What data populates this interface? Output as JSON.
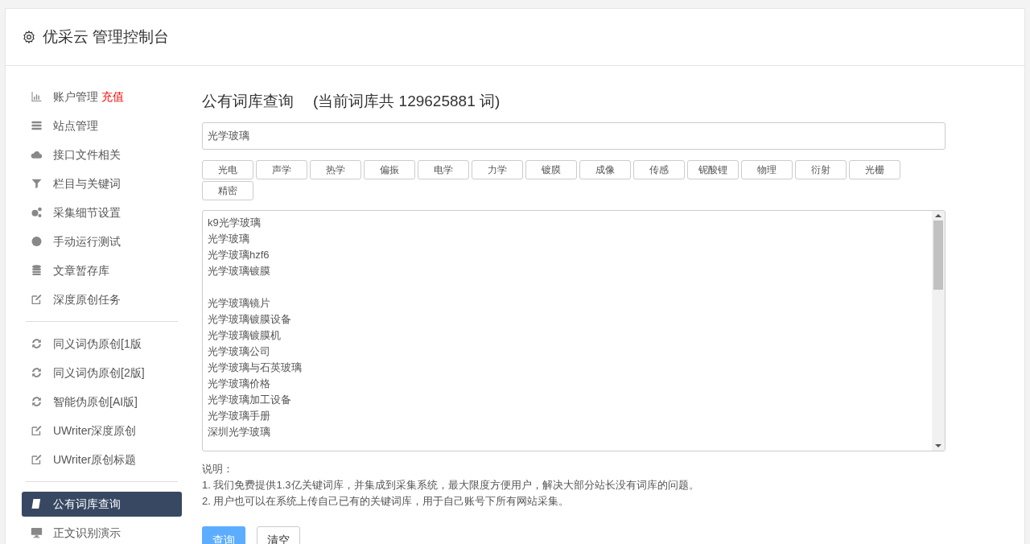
{
  "header": {
    "title": "优采云 管理控制台"
  },
  "sidebar": {
    "groups": [
      {
        "items": [
          {
            "label": "账户管理",
            "badge": "充值",
            "selected": false
          },
          {
            "label": "站点管理",
            "selected": false
          },
          {
            "label": "接口文件相关",
            "selected": false
          },
          {
            "label": "栏目与关键词",
            "selected": false
          },
          {
            "label": "采集细节设置",
            "selected": false
          },
          {
            "label": "手动运行测试",
            "selected": false
          },
          {
            "label": "文章暂存库",
            "selected": false
          },
          {
            "label": "深度原创任务",
            "selected": false
          }
        ]
      },
      {
        "items": [
          {
            "label": "同义词伪原创[1版",
            "selected": false
          },
          {
            "label": "同义词伪原创[2版]",
            "selected": false
          },
          {
            "label": "智能伪原创[AI版]",
            "selected": false
          },
          {
            "label": "UWriter深度原创",
            "selected": false
          },
          {
            "label": "UWriter原创标题",
            "selected": false
          }
        ]
      },
      {
        "items": [
          {
            "label": "公有词库查询",
            "selected": true
          },
          {
            "label": "正文识别演示",
            "selected": false
          }
        ]
      }
    ]
  },
  "main": {
    "title": "公有词库查询",
    "count_note": "(当前词库共 129625881 词)",
    "search_value": "光学玻璃",
    "tags": [
      "光电",
      "声学",
      "热学",
      "偏振",
      "电学",
      "力学",
      "镀膜",
      "成像",
      "传感",
      "铌酸锂",
      "物理",
      "衍射",
      "光栅",
      "精密"
    ],
    "results": [
      {
        "kind": "text",
        "text": "k9光学玻璃"
      },
      {
        "kind": "text",
        "text": "光学玻璃"
      },
      {
        "kind": "text",
        "text": "光学玻璃hzf6"
      },
      {
        "kind": "text",
        "text": "光学玻璃镀膜"
      },
      {
        "kind": "covered"
      },
      {
        "kind": "text",
        "text": "光学玻璃镜片"
      },
      {
        "kind": "text",
        "text": "光学玻璃镀膜设备"
      },
      {
        "kind": "text",
        "text": "光学玻璃镀膜机"
      },
      {
        "kind": "text",
        "text": "光学玻璃公司"
      },
      {
        "kind": "text",
        "text": "光学玻璃与石英玻璃"
      },
      {
        "kind": "text",
        "text": "光学玻璃价格"
      },
      {
        "kind": "text",
        "text": "光学玻璃加工设备"
      },
      {
        "kind": "text",
        "text": "光学玻璃手册"
      },
      {
        "kind": "text",
        "text": "深圳光学玻璃"
      }
    ],
    "notes_title": "说明：",
    "notes": [
      "1. 我们免费提供1.3亿关键词库，并集成到采集系统，最大限度方便用户，解决大部分站长没有词库的问题。",
      "2. 用户也可以在系统上传自己已有的关键词库，用于自己账号下所有网站采集。"
    ],
    "buttons": [
      {
        "kind": "primary",
        "label": "查询"
      },
      {
        "kind": "default",
        "label": "清空"
      }
    ]
  }
}
